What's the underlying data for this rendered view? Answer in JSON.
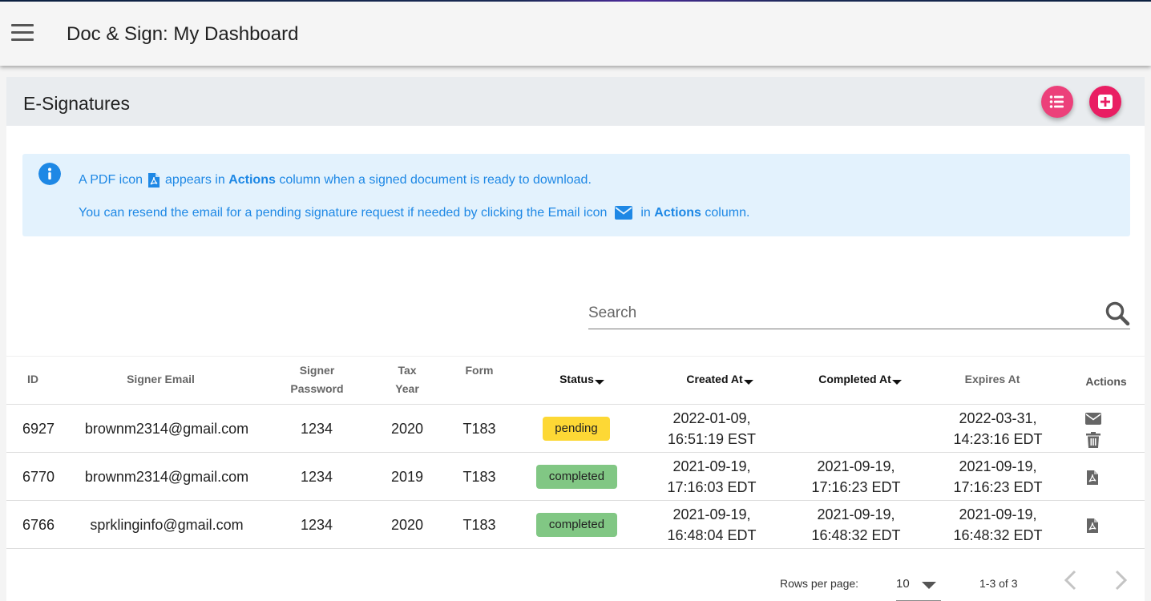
{
  "app": {
    "title": "Doc & Sign: My Dashboard"
  },
  "card": {
    "title": "E-Signatures"
  },
  "info": {
    "line1_pre": "A PDF icon",
    "line1_mid": "appears in",
    "line1_bold": "Actions",
    "line1_post": "column when a signed document is ready to download.",
    "line2_pre": "You can resend the email for a pending signature request if needed by clicking the Email icon",
    "line2_mid": "in",
    "line2_bold": "Actions",
    "line2_post": "column."
  },
  "search": {
    "placeholder": "Search",
    "value": ""
  },
  "table": {
    "headers": {
      "id": "ID",
      "email": "Signer Email",
      "password_1": "Signer",
      "password_2": "Password",
      "tax_1": "Tax",
      "tax_2": "Year",
      "form": "Form",
      "status": "Status",
      "created": "Created At",
      "completed": "Completed At",
      "expires": "Expires At",
      "actions": "Actions"
    },
    "rows": [
      {
        "id": "6927",
        "email": "brownm2314@gmail.com",
        "password": "1234",
        "tax_year": "2020",
        "form": "T183",
        "status": "pending",
        "created_1": "2022-01-09,",
        "created_2": "16:51:19 EST",
        "completed_1": "",
        "completed_2": "",
        "expires_1": "2022-03-31,",
        "expires_2": "14:23:16 EDT",
        "actions": [
          "email-icon",
          "trash-icon"
        ]
      },
      {
        "id": "6770",
        "email": "brownm2314@gmail.com",
        "password": "1234",
        "tax_year": "2019",
        "form": "T183",
        "status": "completed",
        "created_1": "2021-09-19,",
        "created_2": "17:16:03 EDT",
        "completed_1": "2021-09-19,",
        "completed_2": "17:16:23 EDT",
        "expires_1": "2021-09-19,",
        "expires_2": "17:16:23 EDT",
        "actions": [
          "pdf-icon"
        ]
      },
      {
        "id": "6766",
        "email": "sprklinginfo@gmail.com",
        "password": "1234",
        "tax_year": "2020",
        "form": "T183",
        "status": "completed",
        "created_1": "2021-09-19,",
        "created_2": "16:48:04 EDT",
        "completed_1": "2021-09-19,",
        "completed_2": "16:48:32 EDT",
        "expires_1": "2021-09-19,",
        "expires_2": "16:48:32 EDT",
        "actions": [
          "pdf-icon"
        ]
      }
    ]
  },
  "pagination": {
    "rows_per_page_label": "Rows per page:",
    "rows_per_page": "10",
    "range": "1-3 of 3"
  },
  "colors": {
    "accent": "#ec407a",
    "add": "#e91e63",
    "info_bg": "#e3f2fd",
    "info_text": "#1e88e5",
    "pending": "#fdd835",
    "completed": "#81c784"
  }
}
